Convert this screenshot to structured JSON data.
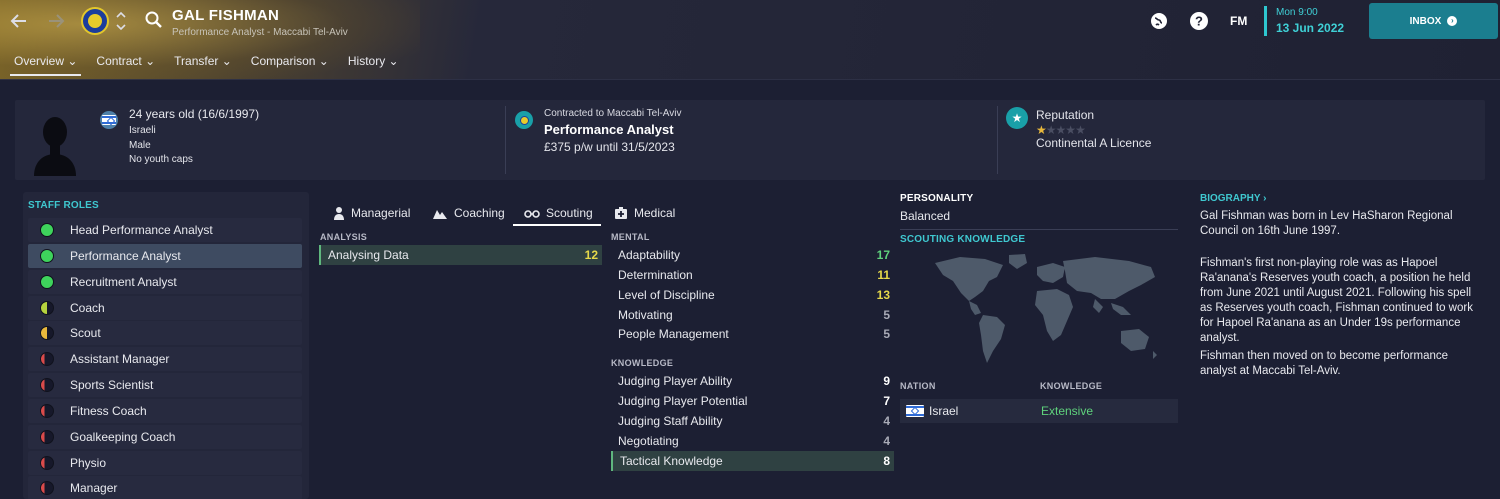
{
  "header": {
    "title": "GAL FISHMAN",
    "subtitle": "Performance Analyst - Maccabi Tel-Aviv",
    "tabs": [
      {
        "label": "Overview ⌄"
      },
      {
        "label": "Contract ⌄"
      },
      {
        "label": "Transfer ⌄"
      },
      {
        "label": "Comparison ⌄"
      },
      {
        "label": "History ⌄"
      }
    ],
    "fm_logo": "FM",
    "time": "Mon 9:00",
    "date": "13 Jun 2022",
    "inbox_label": "INBOX",
    "inbox_arrow": "›"
  },
  "profile": {
    "age_line": "24 years old (16/6/1997)",
    "nationality": "Israeli",
    "gender": "Male",
    "caps": "No youth caps",
    "contract_label": "Contracted to Maccabi Tel-Aviv",
    "role": "Performance Analyst",
    "wage": "£375 p/w until 31/5/2023",
    "reputation_label": "Reputation",
    "reputation_stars": 1,
    "reputation_max": 5,
    "licence": "Continental A Licence"
  },
  "staff_roles": {
    "heading": "STAFF ROLES",
    "selected_index": 1,
    "items": [
      {
        "label": "Head Performance Analyst",
        "suitability": 1.0
      },
      {
        "label": "Performance Analyst",
        "suitability": 1.0
      },
      {
        "label": "Recruitment Analyst",
        "suitability": 1.0
      },
      {
        "label": "Coach",
        "suitability": 0.5
      },
      {
        "label": "Scout",
        "suitability": 0.5
      },
      {
        "label": "Assistant Manager",
        "suitability": 0.25
      },
      {
        "label": "Sports Scientist",
        "suitability": 0.25
      },
      {
        "label": "Fitness Coach",
        "suitability": 0.25
      },
      {
        "label": "Goalkeeping Coach",
        "suitability": 0.25
      },
      {
        "label": "Physio",
        "suitability": 0.25
      },
      {
        "label": "Manager",
        "suitability": 0.25
      }
    ]
  },
  "attribute_tabs": [
    {
      "label": "Managerial"
    },
    {
      "label": "Coaching"
    },
    {
      "label": "Scouting"
    },
    {
      "label": "Medical"
    }
  ],
  "analysis": {
    "heading": "ANALYSIS",
    "items": [
      {
        "name": "Analysing Data",
        "value": "12"
      }
    ]
  },
  "mental": {
    "heading": "MENTAL",
    "items": [
      {
        "name": "Adaptability",
        "value": "17"
      },
      {
        "name": "Determination",
        "value": "11"
      },
      {
        "name": "Level of Discipline",
        "value": "13"
      },
      {
        "name": "Motivating",
        "value": "5"
      },
      {
        "name": "People Management",
        "value": "5"
      }
    ]
  },
  "knowledge": {
    "heading": "KNOWLEDGE",
    "items": [
      {
        "name": "Judging Player Ability",
        "value": "9"
      },
      {
        "name": "Judging Player Potential",
        "value": "7"
      },
      {
        "name": "Judging Staff Ability",
        "value": "4"
      },
      {
        "name": "Negotiating",
        "value": "4"
      },
      {
        "name": "Tactical Knowledge",
        "value": "8"
      }
    ]
  },
  "colors": {
    "value_green": "#5fd27c",
    "value_yellow": "#e6d94a",
    "value_white": "#ffffff",
    "value_grey": "#a8aab6",
    "accent": "#3fc8d0"
  },
  "personality": {
    "heading": "PERSONALITY",
    "value": "Balanced"
  },
  "scouting_knowledge": {
    "heading": "SCOUTING KNOWLEDGE",
    "col_nation": "NATION",
    "col_knowledge": "KNOWLEDGE",
    "rows": [
      {
        "nation": "Israel",
        "knowledge": "Extensive"
      }
    ]
  },
  "biography": {
    "heading": "BIOGRAPHY ›",
    "p1": "Gal Fishman was born in Lev HaSharon Regional Council on 16th June 1997.",
    "p2": "Fishman's first non-playing role was as Hapoel Ra'anana's Reserves youth coach, a position he held from June 2021 until August 2021. Following his spell as Reserves youth coach, Fishman continued to work for Hapoel Ra'anana as an Under 19s performance analyst.",
    "p3": "Fishman then moved on to become performance analyst at Maccabi Tel-Aviv."
  }
}
